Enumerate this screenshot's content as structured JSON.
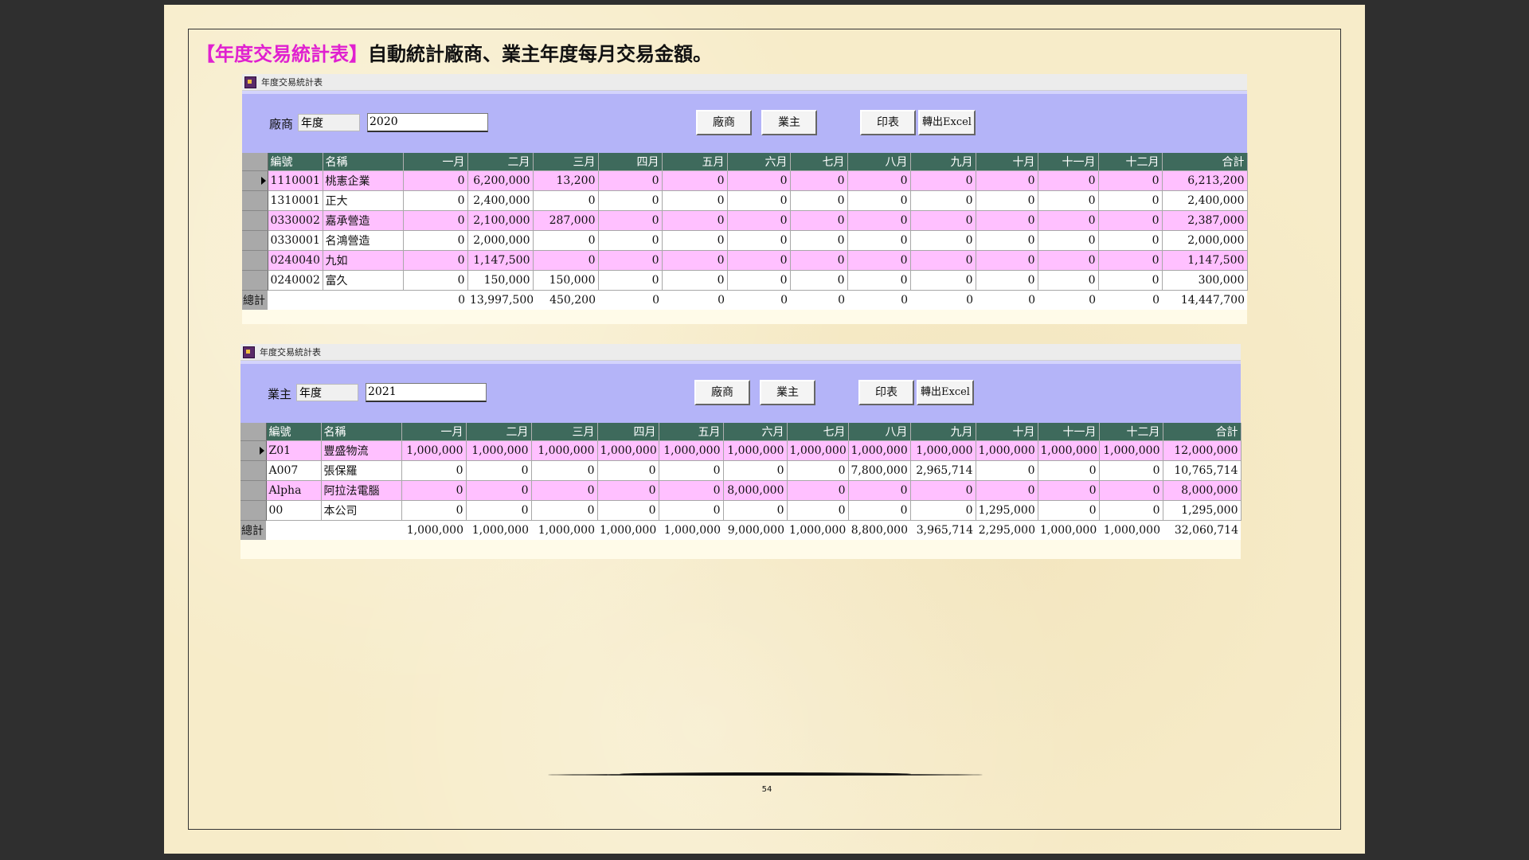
{
  "heading": {
    "highlight": "【年度交易統計表】",
    "text": "自動統計廠商、業主年度每月交易金額。"
  },
  "columns": [
    "編號",
    "名稱",
    "一月",
    "二月",
    "三月",
    "四月",
    "五月",
    "六月",
    "七月",
    "八月",
    "九月",
    "十月",
    "十一月",
    "十二月",
    "合計"
  ],
  "windows": [
    {
      "title": "年度交易統計表",
      "type_label": "廠商",
      "combo_value": "年度",
      "year": "2020",
      "buttons": [
        "廠商",
        "業主",
        "印表",
        "轉出Excel"
      ],
      "rows": [
        [
          "1110001",
          "桃憲企業",
          "0",
          "6,200,000",
          "13,200",
          "0",
          "0",
          "0",
          "0",
          "0",
          "0",
          "0",
          "0",
          "0",
          "6,213,200"
        ],
        [
          "1310001",
          "正大",
          "0",
          "2,400,000",
          "0",
          "0",
          "0",
          "0",
          "0",
          "0",
          "0",
          "0",
          "0",
          "0",
          "2,400,000"
        ],
        [
          "0330002",
          "嘉承營造",
          "0",
          "2,100,000",
          "287,000",
          "0",
          "0",
          "0",
          "0",
          "0",
          "0",
          "0",
          "0",
          "0",
          "2,387,000"
        ],
        [
          "0330001",
          "名鴻營造",
          "0",
          "2,000,000",
          "0",
          "0",
          "0",
          "0",
          "0",
          "0",
          "0",
          "0",
          "0",
          "0",
          "2,000,000"
        ],
        [
          "0240040",
          "九如",
          "0",
          "1,147,500",
          "0",
          "0",
          "0",
          "0",
          "0",
          "0",
          "0",
          "0",
          "0",
          "0",
          "1,147,500"
        ],
        [
          "0240002",
          "富久",
          "0",
          "150,000",
          "150,000",
          "0",
          "0",
          "0",
          "0",
          "0",
          "0",
          "0",
          "0",
          "0",
          "300,000"
        ]
      ],
      "total_label": "總計",
      "totals": [
        "0",
        "13,997,500",
        "450,200",
        "0",
        "0",
        "0",
        "0",
        "0",
        "0",
        "0",
        "0",
        "0",
        "14,447,700"
      ]
    },
    {
      "title": "年度交易統計表",
      "type_label": "業主",
      "combo_value": "年度",
      "year": "2021",
      "buttons": [
        "廠商",
        "業主",
        "印表",
        "轉出Excel"
      ],
      "rows": [
        [
          "Z01",
          "豐盛物流",
          "1,000,000",
          "1,000,000",
          "1,000,000",
          "1,000,000",
          "1,000,000",
          "1,000,000",
          "1,000,000",
          "1,000,000",
          "1,000,000",
          "1,000,000",
          "1,000,000",
          "1,000,000",
          "12,000,000"
        ],
        [
          "A007",
          "張保羅",
          "0",
          "0",
          "0",
          "0",
          "0",
          "0",
          "0",
          "7,800,000",
          "2,965,714",
          "0",
          "0",
          "0",
          "10,765,714"
        ],
        [
          "Alpha",
          "阿拉法電腦",
          "0",
          "0",
          "0",
          "0",
          "0",
          "8,000,000",
          "0",
          "0",
          "0",
          "0",
          "0",
          "0",
          "8,000,000"
        ],
        [
          "00",
          "本公司",
          "0",
          "0",
          "0",
          "0",
          "0",
          "0",
          "0",
          "0",
          "0",
          "1,295,000",
          "0",
          "0",
          "1,295,000"
        ]
      ],
      "total_label": "總計",
      "totals": [
        "1,000,000",
        "1,000,000",
        "1,000,000",
        "1,000,000",
        "1,000,000",
        "9,000,000",
        "1,000,000",
        "8,800,000",
        "3,965,714",
        "2,295,000",
        "1,000,000",
        "1,000,000",
        "32,060,714"
      ]
    }
  ],
  "page_number": "54"
}
